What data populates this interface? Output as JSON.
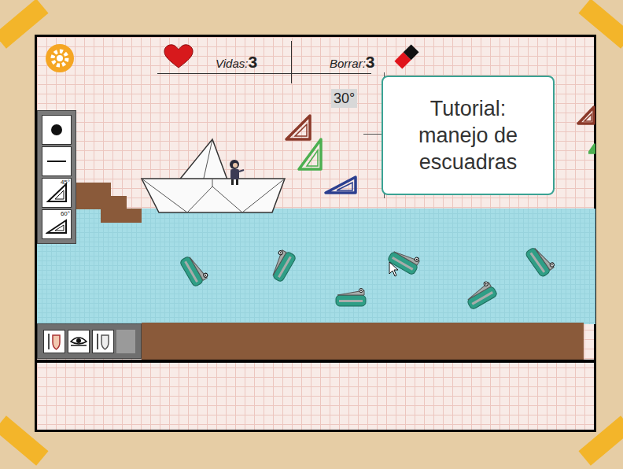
{
  "hud": {
    "lives_label": "Vidas:",
    "lives": "3",
    "erase_label": "Borrar:",
    "erase": "3"
  },
  "angle_label": "30°",
  "tutorial": {
    "lines": [
      "Tutorial:",
      "manejo de",
      "escuadras"
    ]
  },
  "tools": [
    {
      "kind": "point",
      "label": "",
      "selected": false
    },
    {
      "kind": "line",
      "label": "",
      "selected": false
    },
    {
      "kind": "square45",
      "label": "45°",
      "selected": false
    },
    {
      "kind": "square60",
      "label": "60°",
      "selected": false
    }
  ],
  "powerups": [
    {
      "kind": "shield",
      "selected": false
    },
    {
      "kind": "eye",
      "selected": false
    },
    {
      "kind": "armor",
      "selected": false
    }
  ],
  "triangles": [
    {
      "color": "#8b3a2a"
    },
    {
      "color": "#4caf50"
    },
    {
      "color": "#2b3f8f"
    },
    {
      "color": "#8b3a2a"
    },
    {
      "color": "#4caf50"
    }
  ]
}
